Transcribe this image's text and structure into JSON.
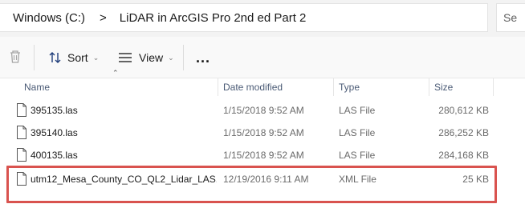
{
  "addressbar": {
    "crumbs": [
      "Windows (C:)",
      "LiDAR in ArcGIS Pro 2nd ed Part 2"
    ],
    "separator": ">",
    "search_placeholder": "Se"
  },
  "toolbar": {
    "sort_label": "Sort",
    "view_label": "View",
    "more_label": "..."
  },
  "columns": {
    "name": "Name",
    "date": "Date modified",
    "type": "Type",
    "size": "Size"
  },
  "files": [
    {
      "name": "395135.las",
      "date": "1/15/2018 9:52 AM",
      "type": "LAS File",
      "size": "280,612 KB"
    },
    {
      "name": "395140.las",
      "date": "1/15/2018 9:52 AM",
      "type": "LAS File",
      "size": "286,252 KB"
    },
    {
      "name": "400135.las",
      "date": "1/15/2018 9:52 AM",
      "type": "LAS File",
      "size": "284,168 KB"
    },
    {
      "name": "utm12_Mesa_County_CO_QL2_Lidar_LAS...",
      "date": "12/19/2016 9:11 AM",
      "type": "XML File",
      "size": "25 KB"
    }
  ],
  "colors": {
    "highlight_border": "#d9534f",
    "header_text": "#4a5a75"
  },
  "icons": {
    "delete": "trash-icon",
    "sort": "sort-icon",
    "view": "view-icon",
    "file": "file-icon"
  }
}
